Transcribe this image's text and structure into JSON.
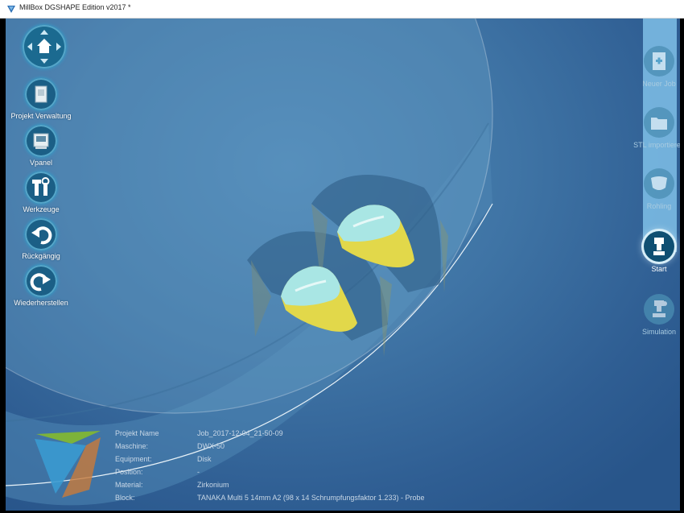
{
  "window": {
    "title": "MillBox DGSHAPE Edition v2017 *"
  },
  "left_toolbar": {
    "nav_label": "",
    "items": [
      {
        "label": "Projekt Verwaltung",
        "icon": "project-management-icon"
      },
      {
        "label": "Vpanel",
        "icon": "vpanel-icon"
      },
      {
        "label": "Werkzeuge",
        "icon": "tools-icon"
      },
      {
        "label": "Rückgängig",
        "icon": "undo-icon"
      },
      {
        "label": "Wiederherstellen",
        "icon": "redo-icon"
      }
    ]
  },
  "right_toolbar": {
    "items": [
      {
        "label": "Neuer Job",
        "icon": "new-job-icon",
        "state": "disabled"
      },
      {
        "label": "STL importieren",
        "icon": "stl-import-icon",
        "state": "disabled"
      },
      {
        "label": "Rohling",
        "icon": "blank-icon",
        "state": "disabled"
      },
      {
        "label": "Start",
        "icon": "start-mill-icon",
        "state": "active"
      },
      {
        "label": "Simulation",
        "icon": "simulation-icon",
        "state": "disabled"
      }
    ]
  },
  "project_info": {
    "rows": [
      {
        "key": "Projekt Name",
        "value": "Job_2017-12-04_21-50-09"
      },
      {
        "key": "Maschine:",
        "value": "DWX-50"
      },
      {
        "key": "Equipment:",
        "value": "Disk"
      },
      {
        "key": "Position:",
        "value": "-"
      },
      {
        "key": "Material:",
        "value": "Zirkonium"
      },
      {
        "key": "Block:",
        "value": "TANAKA Multi 5 14mm A2 (98 x 14 Schrumpfungsfaktor 1.233) - Probe"
      }
    ]
  },
  "colors": {
    "background": "#3f74a5",
    "toolbar_circle": "#1b5f86",
    "right_rail": "#7fc0e8",
    "tooth_enamel": "#a9e6e4",
    "tooth_body": "#e2d84a"
  }
}
